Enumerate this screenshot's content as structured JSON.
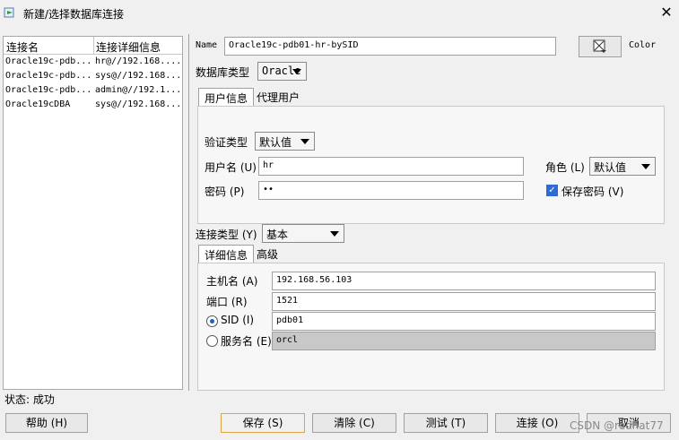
{
  "window": {
    "title": "新建/选择数据库连接",
    "close_icon": "close-icon"
  },
  "connections": {
    "headers": [
      "连接名",
      "连接详细信息"
    ],
    "rows": [
      [
        "Oracle19c-pdb...",
        "hr@//192.168...."
      ],
      [
        "Oracle19c-pdb...",
        "sys@//192.168...."
      ],
      [
        "Oracle19c-pdb...",
        "admin@//192.1..."
      ],
      [
        "Oracle19cDBA",
        "sys@//192.168...."
      ]
    ]
  },
  "form": {
    "name_label": "Name",
    "name_value": "Oracle19c-pdb01-hr-bySID",
    "color_label": "Color",
    "db_type_label": "数据库类型",
    "db_type_value": "Oracle",
    "tabs": [
      "用户信息",
      "代理用户"
    ],
    "auth_type_label": "验证类型",
    "auth_type_value": "默认值",
    "username_label": "用户名 (U)",
    "username_value": "hr",
    "role_label": "角色 (L)",
    "role_value": "默认值",
    "password_label": "密码 (P)",
    "password_value": "••",
    "save_password_label": "保存密码 (V)",
    "conn_type_label": "连接类型 (Y)",
    "conn_type_value": "基本",
    "detail_tabs": [
      "详细信息",
      "高级"
    ],
    "host_label": "主机名 (A)",
    "host_value": "192.168.56.103",
    "port_label": "端口 (R)",
    "port_value": "1521",
    "sid_label": "SID (I)",
    "sid_value": "pdb01",
    "service_label": "服务名 (E)",
    "service_value": "orcl"
  },
  "status": {
    "text": "状态: 成功"
  },
  "buttons": {
    "help": "帮助 (H)",
    "save": "保存 (S)",
    "clear": "清除 (C)",
    "test": "测试 (T)",
    "connect": "连接 (O)",
    "cancel": "取消"
  },
  "watermark": "CSDN @redhat77"
}
